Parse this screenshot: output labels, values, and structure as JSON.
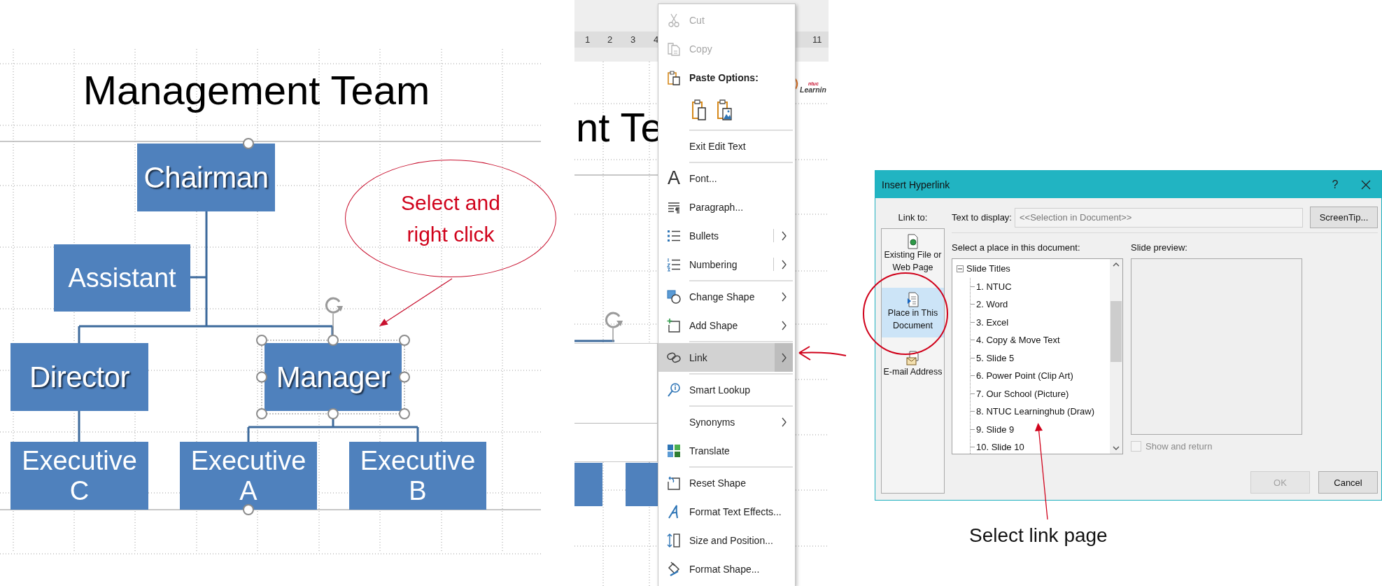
{
  "slide": {
    "title": "Management Team",
    "nodes": [
      {
        "label": "Chairman",
        "kind": "shadow",
        "selected": false
      },
      {
        "label": "Assistant",
        "kind": "plain",
        "selected": false
      },
      {
        "label": "Director",
        "kind": "shadow",
        "selected": false
      },
      {
        "label": "Manager",
        "kind": "shadow",
        "selected": true
      },
      {
        "label": "Executive C",
        "kind": "plain",
        "selected": false
      },
      {
        "label": "Executive A",
        "kind": "plain",
        "selected": false
      },
      {
        "label": "Executive B",
        "kind": "plain",
        "selected": false
      }
    ],
    "callout": "Select and right click"
  },
  "editor": {
    "ruler": [
      "1",
      "2",
      "3",
      "4",
      "11"
    ],
    "title_fragment": "nt Te",
    "logo": {
      "tag": "ntuc",
      "text": "Learnin"
    }
  },
  "context_menu": {
    "items": [
      {
        "kind": "command",
        "label": "Cut",
        "disabled": true,
        "selected": false
      },
      {
        "kind": "command",
        "label": "Copy",
        "disabled": true,
        "selected": false
      },
      {
        "kind": "heading",
        "label": "Paste Options:"
      },
      {
        "kind": "paste_icons"
      },
      {
        "kind": "separator"
      },
      {
        "kind": "command",
        "label": "Exit Edit Text",
        "disabled": false,
        "selected": false
      },
      {
        "kind": "separator"
      },
      {
        "kind": "command",
        "label": "Font...",
        "glyph": "A",
        "disabled": false,
        "selected": false
      },
      {
        "kind": "command",
        "label": "Paragraph...",
        "disabled": false,
        "selected": false
      },
      {
        "kind": "command",
        "label": "Bullets",
        "submenu": true,
        "split": true,
        "disabled": false,
        "selected": false
      },
      {
        "kind": "command",
        "label": "Numbering",
        "submenu": true,
        "split": true,
        "disabled": false,
        "selected": false
      },
      {
        "kind": "separator"
      },
      {
        "kind": "command",
        "label": "Change Shape",
        "submenu": true,
        "split": false,
        "disabled": false,
        "selected": false
      },
      {
        "kind": "command",
        "label": "Add Shape",
        "submenu": true,
        "split": false,
        "disabled": false,
        "selected": false
      },
      {
        "kind": "separator"
      },
      {
        "kind": "command",
        "label": "Link",
        "submenu": true,
        "split": false,
        "disabled": false,
        "selected": true
      },
      {
        "kind": "separator"
      },
      {
        "kind": "command",
        "label": "Smart Lookup",
        "disabled": false,
        "selected": false
      },
      {
        "kind": "separator"
      },
      {
        "kind": "command",
        "label": "Synonyms",
        "submenu": true,
        "split": false,
        "disabled": false,
        "selected": false
      },
      {
        "kind": "command",
        "label": "Translate",
        "disabled": false,
        "selected": false
      },
      {
        "kind": "separator"
      },
      {
        "kind": "command",
        "label": "Reset Shape",
        "disabled": false,
        "selected": false
      },
      {
        "kind": "command",
        "label": "Format Text Effects...",
        "disabled": false,
        "selected": false
      },
      {
        "kind": "command",
        "label": "Size and Position...",
        "disabled": false,
        "selected": false
      },
      {
        "kind": "command",
        "label": "Format Shape...",
        "disabled": false,
        "selected": false
      }
    ]
  },
  "dialog": {
    "title": "Insert Hyperlink",
    "help": "?",
    "link_to": {
      "label": "Link to:",
      "items": [
        {
          "label": "Existing File or Web Page",
          "selected": false
        },
        {
          "label": "Place in This Document",
          "selected": true
        },
        {
          "label": "E-mail Address",
          "selected": false
        }
      ]
    },
    "text_to_display": {
      "label": "Text to display:",
      "value": "<<Selection in Document>>",
      "disabled": true
    },
    "screentip_button": "ScreenTip...",
    "place_list": {
      "label": "Select a place in this document:",
      "tree": [
        {
          "label": "Slide Titles",
          "expanded": true,
          "selected": false,
          "children": [
            {
              "label": "1. NTUC",
              "selected": false
            },
            {
              "label": "2. Word",
              "selected": false
            },
            {
              "label": "3. Excel",
              "selected": false
            },
            {
              "label": "4. Copy & Move Text",
              "selected": false
            },
            {
              "label": "5. Slide 5",
              "selected": false
            },
            {
              "label": "6. Power Point (Clip Art)",
              "selected": false
            },
            {
              "label": "7. Our School (Picture)",
              "selected": false
            },
            {
              "label": "8. NTUC Learninghub (Draw)",
              "selected": false
            },
            {
              "label": "9. Slide 9",
              "selected": false
            },
            {
              "label": "10. Slide 10",
              "selected": false
            }
          ]
        }
      ]
    },
    "slide_preview": {
      "label": "Slide preview:"
    },
    "show_and_return": {
      "label": "Show and return",
      "checked": false,
      "disabled": true
    },
    "buttons": [
      {
        "label": "OK",
        "disabled": true
      },
      {
        "label": "Cancel",
        "disabled": false
      }
    ]
  },
  "caption": "Select link page"
}
